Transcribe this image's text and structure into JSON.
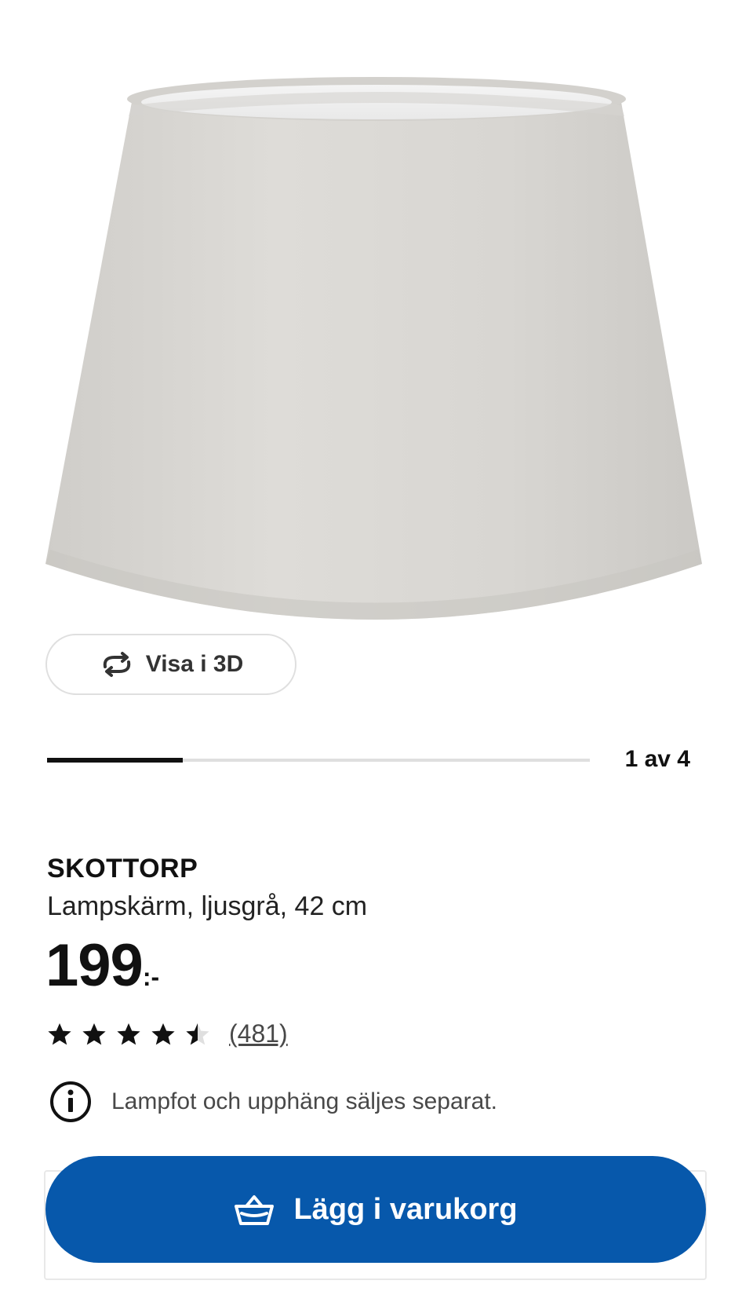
{
  "gallery": {
    "view3d_label": "Visa i 3D",
    "progress_fraction": 0.25,
    "counter": "1 av 4"
  },
  "product": {
    "name": "SKOTTORP",
    "description": "Lampskärm, ljusgrå, 42 cm",
    "price": "199",
    "price_suffix": ":-",
    "rating": 4.5,
    "rating_max": 5,
    "review_count": "(481)",
    "notice": "Lampfot och upphäng säljes separat."
  },
  "cart": {
    "label": "Lägg i varukorg"
  },
  "colors": {
    "accent": "#0758ab",
    "text": "#111111",
    "muted": "#484848"
  },
  "icons": {
    "view3d": "rotate-3d-icon",
    "info": "info-icon",
    "cart": "shopping-basket-icon",
    "star": "star-icon"
  }
}
